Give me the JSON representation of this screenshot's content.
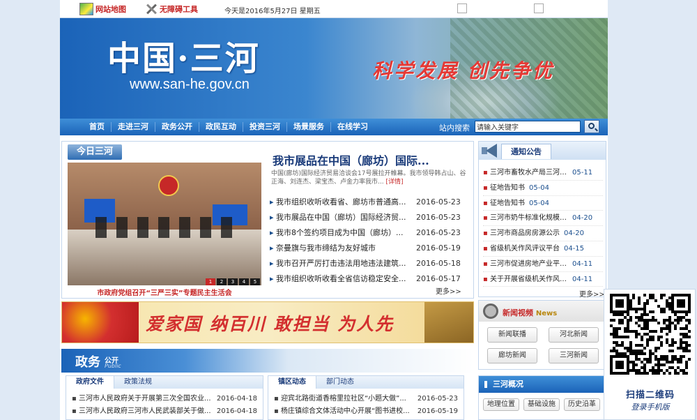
{
  "topbar": {
    "site_map": "网站地图",
    "accessibility": "无障碍工具",
    "date": "今天是2016年5月27日 星期五"
  },
  "banner": {
    "title": "中国·三河",
    "url": "www.san-he.gov.cn",
    "slogan": "科学发展  创先争优"
  },
  "nav": {
    "items": [
      "首页",
      "走进三河",
      "政务公开",
      "政民互动",
      "投资三河",
      "场景服务",
      "在线学习"
    ],
    "search_label": "站内搜索",
    "search_value": "请输入关键字"
  },
  "today": {
    "tab": "今日三河",
    "headline": "我市展品在中国（廊坊）国际...",
    "summary": "中国(廊坊)国际经济贸易洽谈会17号展拉开帷幕。我市领导韩占山、谷正海、刘连杰、梁宝杰、卢金力率我市...",
    "summary_more": "[详情]",
    "photo_caption": "市政府党组召开“三严三实”专题民主生活会",
    "photo_dots": [
      "1",
      "2",
      "3",
      "4",
      "5"
    ],
    "news": [
      {
        "title": "我市组织收听收看省、廊坊市普通高...",
        "date": "2016-05-23"
      },
      {
        "title": "我市展品在中国（廊坊）国际经济贸...",
        "date": "2016-05-23"
      },
      {
        "title": "我市8个签约项目成为中国（廊坊）...",
        "date": "2016-05-23"
      },
      {
        "title": "奈曼旗与我市缔结为友好城市",
        "date": "2016-05-19"
      },
      {
        "title": "我市召开严厉打击违法用地违法建筑...",
        "date": "2016-05-18"
      },
      {
        "title": "我市组织收听收看全省信访稳定安全...",
        "date": "2016-05-17"
      }
    ],
    "more": "更多>>"
  },
  "notice": {
    "tab": "通知公告",
    "items": [
      {
        "title": "三河市畜牧水产局三河市...",
        "date": "05-11"
      },
      {
        "title": "征地告知书",
        "date": "05-04"
      },
      {
        "title": "征地告知书",
        "date": "05-04"
      },
      {
        "title": "三河市奶牛标准化规模养...",
        "date": "04-20"
      },
      {
        "title": "三河市商品房房源公示",
        "date": "04-20"
      },
      {
        "title": "省级机关作风评议平台",
        "date": "04-15"
      },
      {
        "title": "三河市促进房地产业平稳...",
        "date": "04-11"
      },
      {
        "title": "关于开展省级机关作风公...",
        "date": "04-11"
      }
    ],
    "more": "更多>>"
  },
  "slogan_bar": {
    "text": "爱家国  纳百川  敢担当  为人先"
  },
  "video": {
    "title": "新闻视频",
    "title_en": "News",
    "buttons": [
      "新闻联播",
      "河北新闻",
      "廊坊新闻",
      "三河新闻"
    ]
  },
  "gov": {
    "big": "政务",
    "small": "公开",
    "pub": "Public"
  },
  "gov_files": {
    "tabs": [
      "政府文件",
      "政策法规"
    ],
    "items": [
      {
        "title": "三河市人民政府关于开展第三次全国农业...",
        "date": "2016-04-18"
      },
      {
        "title": "三河市人民政府三河市人民武装部关于做...",
        "date": "2016-04-18"
      }
    ]
  },
  "town_news": {
    "tabs": [
      "镇区动态",
      "部门动态"
    ],
    "items": [
      {
        "title": "迎宾北路街道香榕里拉社区“小题大做”...",
        "date": "2016-05-23"
      },
      {
        "title": "杨庄镇综合文体活动中心开展“图书进校...",
        "date": "2016-05-19"
      }
    ]
  },
  "overview": {
    "title": "三河概况",
    "buttons": [
      "地理位置",
      "基础设施",
      "历史沿革"
    ]
  },
  "qr": {
    "caption": "扫描二维码",
    "sub": "登录手机版"
  },
  "colors": {
    "nav_blue": "#1b63b8",
    "slogan_red": "#d32f2f",
    "heading_navy": "#1a3b7a"
  }
}
